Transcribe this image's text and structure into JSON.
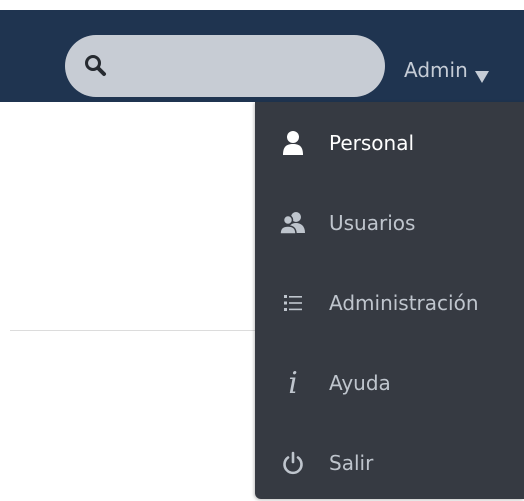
{
  "colors": {
    "navbar_bg": "#1f3450",
    "search_bg": "#c7ccd4",
    "dropdown_bg": "#363a42",
    "active_text": "#ffffff",
    "muted_text": "#bfc5cd"
  },
  "search": {
    "icon": "search-icon",
    "value": "",
    "placeholder": ""
  },
  "user_menu": {
    "label": "Admin",
    "caret_icon": "caret-down-icon"
  },
  "dropdown": {
    "items": [
      {
        "label": "Personal",
        "icon": "person-icon",
        "active": true
      },
      {
        "label": "Usuarios",
        "icon": "users-icon",
        "active": false
      },
      {
        "label": "Administración",
        "icon": "list-icon",
        "active": false
      },
      {
        "label": "Ayuda",
        "icon": "info-icon",
        "active": false
      },
      {
        "label": "Salir",
        "icon": "power-icon",
        "active": false
      }
    ]
  }
}
